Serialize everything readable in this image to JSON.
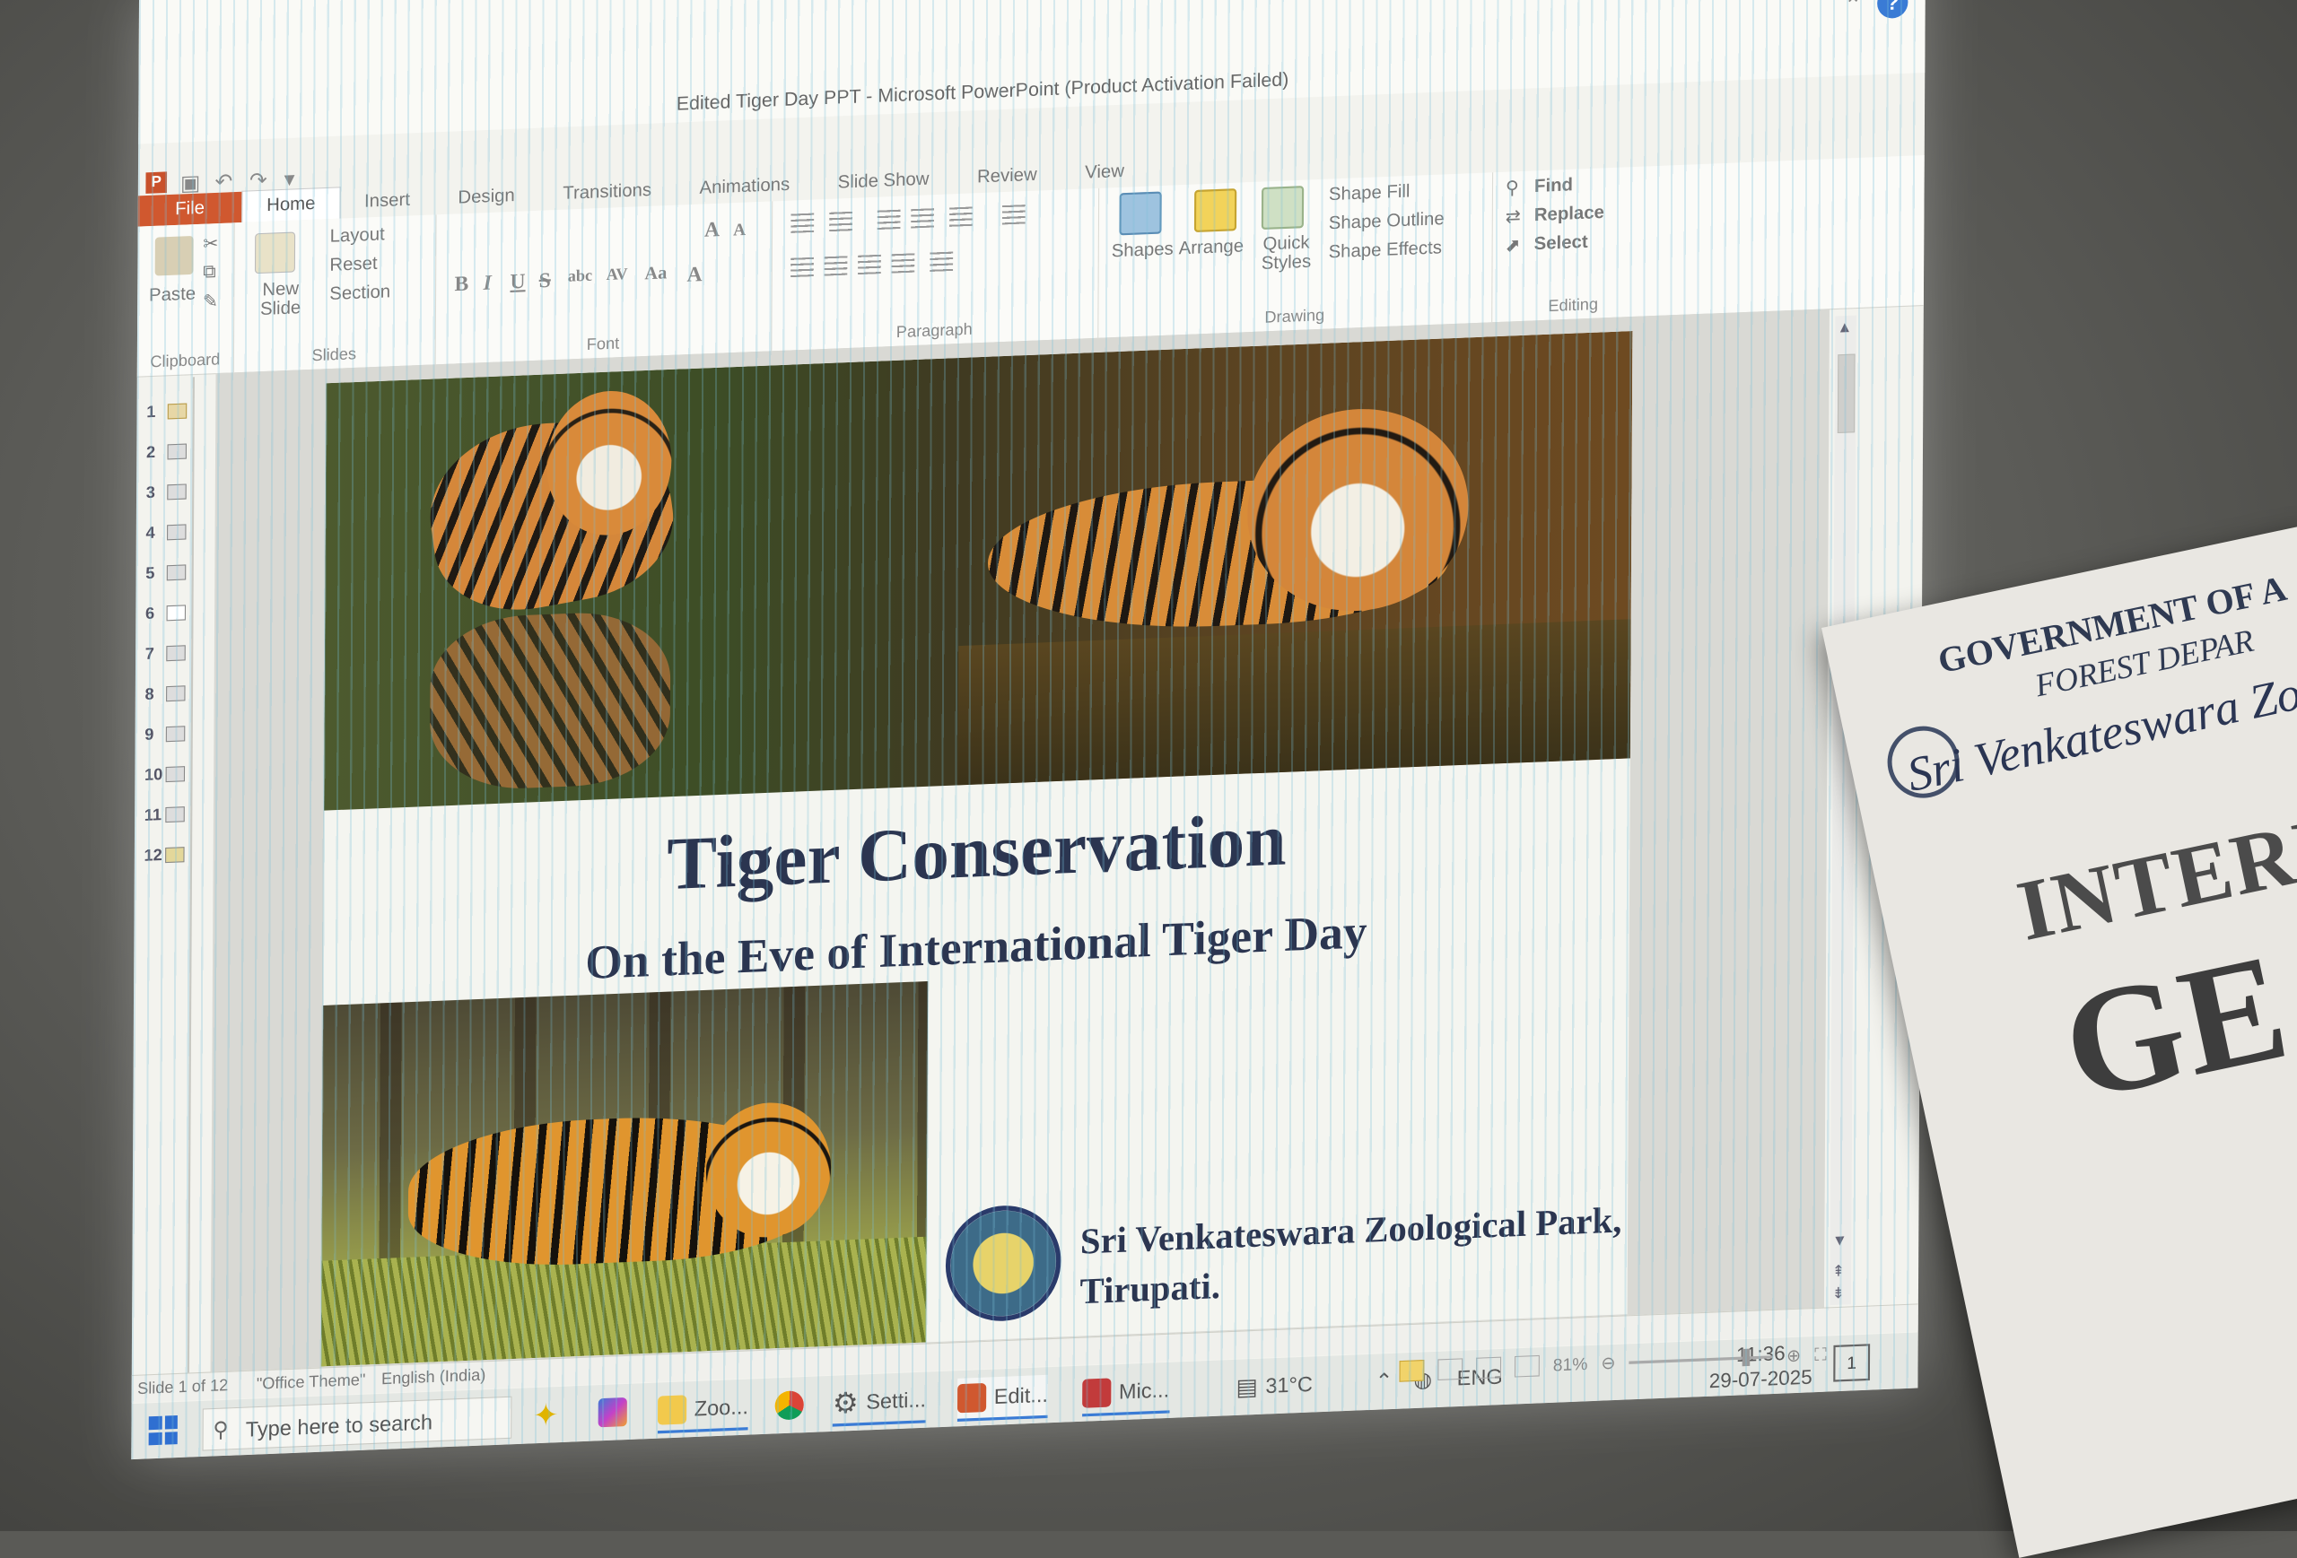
{
  "window": {
    "title": "Edited Tiger Day PPT - Microsoft PowerPoint (Product Activation Failed)",
    "controls": [
      "–",
      "❐",
      "✕"
    ],
    "help_glyph": "?"
  },
  "ribbon": {
    "tabs": [
      "File",
      "Home",
      "Insert",
      "Design",
      "Transitions",
      "Animations",
      "Slide Show",
      "Review",
      "View"
    ],
    "clipboard": {
      "paste": "Paste",
      "label": "Clipboard"
    },
    "slides": {
      "new_slide": "New Slide",
      "layout": "Layout",
      "reset": "Reset",
      "section": "Section",
      "label": "Slides"
    },
    "font": {
      "label": "Font",
      "bold": "B",
      "italic": "I",
      "underline": "U",
      "strike": "S",
      "shadow": "abc",
      "spacing": "AV",
      "case": "Aa",
      "grow": "A",
      "shrink": "A",
      "color": "A"
    },
    "paragraph": {
      "label": "Paragraph"
    },
    "drawing": {
      "shapes": "Shapes",
      "arrange": "Arrange",
      "quick_styles": "Quick Styles",
      "shape_fill": "Shape Fill",
      "shape_outline": "Shape Outline",
      "shape_effects": "Shape Effects",
      "label": "Drawing"
    },
    "editing": {
      "find": "Find",
      "replace": "Replace",
      "select": "Select",
      "label": "Editing"
    }
  },
  "thumbnails": [
    "1",
    "2",
    "3",
    "4",
    "5",
    "6",
    "7",
    "8",
    "9",
    "10",
    "11",
    "12"
  ],
  "selected_slide": "1",
  "slide": {
    "title": "Tiger Conservation",
    "subtitle": "On the Eve of International Tiger Day",
    "org_line1": "Sri Venkateswara Zoological Park,",
    "org_line2": "Tirupati."
  },
  "status_bar": {
    "slide": "Slide 1 of 12",
    "theme": "\"Office Theme\"",
    "language": "English (India)",
    "zoom": "81%"
  },
  "taskbar": {
    "search_placeholder": "Type here to search",
    "items": [
      "Zoo...",
      "Setti...",
      "Edit...",
      "Mic..."
    ],
    "weather": "31°C",
    "lang": "ENG",
    "time": "11:36",
    "date": "29-07-2025",
    "notifications": "1"
  },
  "banner": {
    "line1": "GOVERNMENT OF A",
    "line2": "FOREST DEPAR",
    "line3": "Sri Venkateswara Zoologic",
    "line4": "INTERNATI",
    "line5": "GE"
  },
  "colors": {
    "accent": "#d0582f",
    "slide_text": "#2b3550",
    "taskbar_accent": "#3a7bd5"
  }
}
